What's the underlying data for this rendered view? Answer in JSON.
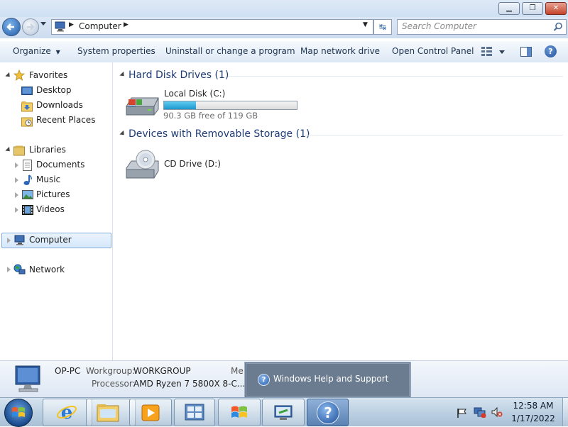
{
  "window": {
    "minimize_glyph": "▁",
    "maximize_glyph": "❐",
    "close_glyph": "✕"
  },
  "nav": {
    "address_segment": "Computer",
    "search_placeholder": "Search Computer",
    "refresh_glyph": "↹"
  },
  "commands": {
    "organize": "Organize",
    "system_properties": "System properties",
    "uninstall": "Uninstall or change a program",
    "map_drive": "Map network drive",
    "open_control_panel": "Open Control Panel"
  },
  "sidebar": {
    "favorites": "Favorites",
    "desktop": "Desktop",
    "downloads": "Downloads",
    "recent_places": "Recent Places",
    "libraries": "Libraries",
    "documents": "Documents",
    "music": "Music",
    "pictures": "Pictures",
    "videos": "Videos",
    "computer": "Computer",
    "network": "Network"
  },
  "content": {
    "hdd_group": "Hard Disk Drives (1)",
    "removable_group": "Devices with Removable Storage (1)",
    "local_disk": {
      "name": "Local Disk (C:)",
      "free_text": "90.3 GB free of 119 GB",
      "used_fraction": 0.241
    },
    "cd_drive": {
      "name": "CD Drive (D:)"
    }
  },
  "details": {
    "pc_name": "OP-PC",
    "workgroup_label": "Workgroup:",
    "workgroup_value": "WORKGROUP",
    "memory_label_partial": "Me",
    "processor_label": "Processor:",
    "processor_value": "AMD Ryzen 7 5800X 8-C..."
  },
  "popup": {
    "label": "Windows Help and Support"
  },
  "taskbar": {
    "time": "12:58 AM",
    "date": "1/17/2022",
    "help_glyph": "?"
  },
  "colors": {
    "accent": "#1e3d78",
    "progress_fill": "#2aa7d8"
  }
}
